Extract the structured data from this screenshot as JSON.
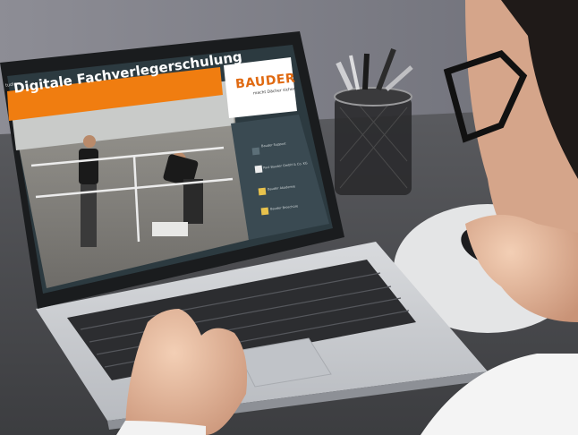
{
  "screen": {
    "tab_label": "tudio",
    "banner_title": "Digitale Fachverlegerschulung",
    "logo_text": "BAUDER",
    "logo_tagline": "macht Dächer sicher.",
    "sidebar": [
      {
        "label": "Bauder Support",
        "icon": "person-icon"
      },
      {
        "label": "Paul Bauder GmbH & Co. KG",
        "icon": "bauder-logo-icon"
      },
      {
        "label": "Bauder Akademie",
        "icon": "folder-icon"
      },
      {
        "label": "Bauder Broschüre",
        "icon": "folder-icon"
      }
    ]
  },
  "colors": {
    "banner": "#f07d10",
    "screen_bg": "#2c3a40",
    "sidebar_bg": "#3a4a52",
    "desk": "#4b4c4f",
    "laptop": "#c9ccd0"
  }
}
